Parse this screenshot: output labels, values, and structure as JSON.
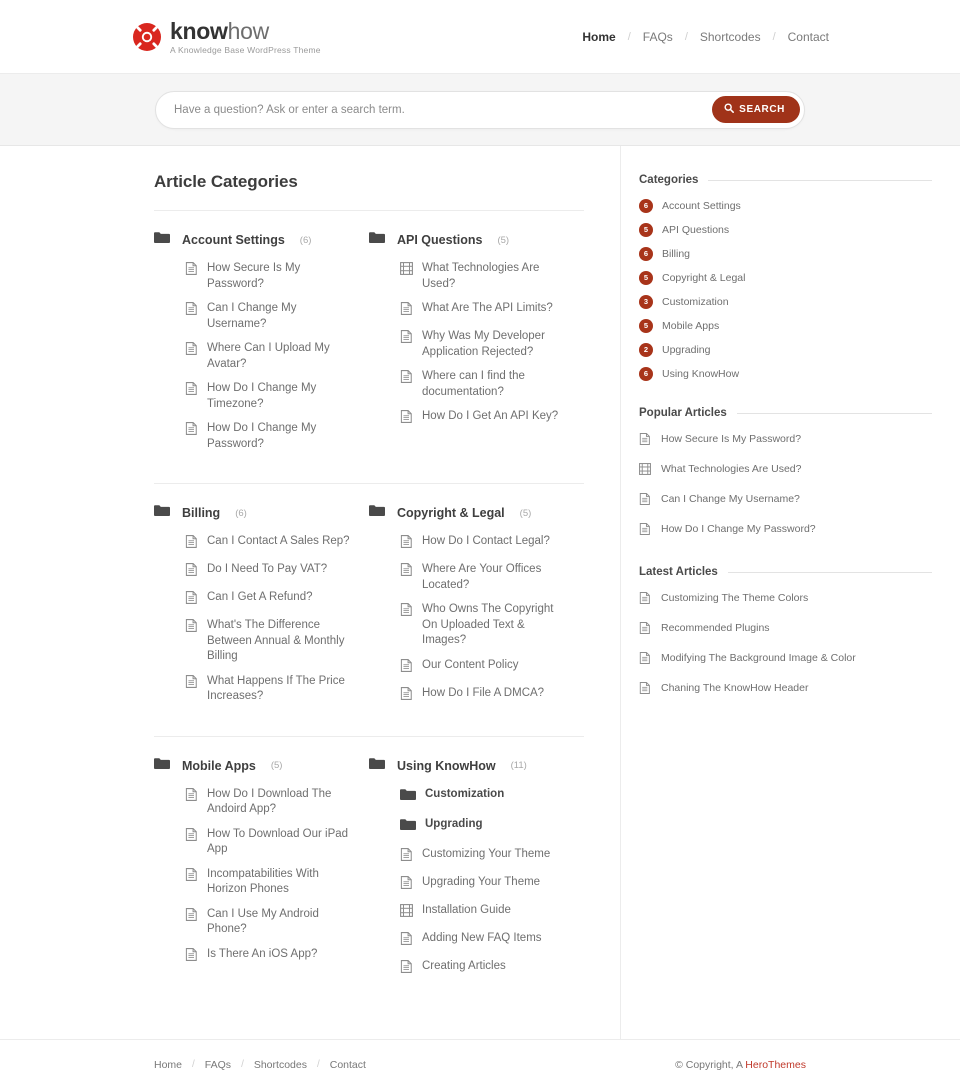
{
  "header": {
    "logo": {
      "icon": "life-ring-icon",
      "title_bold": "know",
      "title_light": "how",
      "tagline": "A Knowledge Base WordPress Theme",
      "brand_color": "#d9271f"
    },
    "nav": [
      {
        "label": "Home",
        "active": true
      },
      {
        "label": "FAQs",
        "active": false
      },
      {
        "label": "Shortcodes",
        "active": false
      },
      {
        "label": "Contact",
        "active": false
      }
    ],
    "nav_separator": "/"
  },
  "search": {
    "placeholder": "Have a question? Ask or enter a search term.",
    "value": "",
    "button_label": "SEARCH",
    "button_icon": "search-icon",
    "button_color": "#a03319"
  },
  "main": {
    "title": "Article Categories",
    "rows": [
      {
        "columns": [
          {
            "name": "Account Settings",
            "count": "(6)",
            "icon": "folder-icon",
            "articles": [
              {
                "label": "How Secure Is My Password?",
                "icon": "document-icon"
              },
              {
                "label": "Can I Change My Username?",
                "icon": "document-icon"
              },
              {
                "label": "Where Can I Upload My Avatar?",
                "icon": "document-icon"
              },
              {
                "label": "How Do I Change My Timezone?",
                "icon": "document-icon"
              },
              {
                "label": "How Do I Change My Password?",
                "icon": "document-icon"
              }
            ]
          },
          {
            "name": "API Questions",
            "count": "(5)",
            "icon": "folder-icon",
            "articles": [
              {
                "label": "What Technologies Are Used?",
                "icon": "video-icon"
              },
              {
                "label": "What Are The API Limits?",
                "icon": "document-icon"
              },
              {
                "label": "Why Was My Developer Application Rejected?",
                "icon": "document-icon"
              },
              {
                "label": "Where can I find the documentation?",
                "icon": "document-icon"
              },
              {
                "label": "How Do I Get An API Key?",
                "icon": "document-icon"
              }
            ]
          }
        ]
      },
      {
        "columns": [
          {
            "name": "Billing",
            "count": "(6)",
            "icon": "folder-icon",
            "articles": [
              {
                "label": "Can I Contact A Sales Rep?",
                "icon": "document-icon"
              },
              {
                "label": "Do I Need To Pay VAT?",
                "icon": "document-icon"
              },
              {
                "label": "Can I Get A Refund?",
                "icon": "document-icon"
              },
              {
                "label": "What's The Difference Between Annual & Monthly Billing",
                "icon": "document-icon"
              },
              {
                "label": "What Happens If The Price Increases?",
                "icon": "document-icon"
              }
            ]
          },
          {
            "name": "Copyright & Legal",
            "count": "(5)",
            "icon": "folder-icon",
            "articles": [
              {
                "label": "How Do I Contact Legal?",
                "icon": "document-icon"
              },
              {
                "label": "Where Are Your Offices Located?",
                "icon": "document-icon"
              },
              {
                "label": "Who Owns The Copyright On Uploaded Text & Images?",
                "icon": "document-icon"
              },
              {
                "label": "Our Content Policy",
                "icon": "document-icon"
              },
              {
                "label": "How Do I File A DMCA?",
                "icon": "document-icon"
              }
            ]
          }
        ]
      },
      {
        "columns": [
          {
            "name": "Mobile Apps",
            "count": "(5)",
            "icon": "folder-icon",
            "articles": [
              {
                "label": "How Do I Download The Andoird App?",
                "icon": "document-icon"
              },
              {
                "label": "How To Download Our iPad App",
                "icon": "document-icon"
              },
              {
                "label": "Incompatabilities With Horizon Phones",
                "icon": "document-icon"
              },
              {
                "label": "Can I Use My Android Phone?",
                "icon": "document-icon"
              },
              {
                "label": "Is There An iOS App?",
                "icon": "document-icon"
              }
            ]
          },
          {
            "name": "Using KnowHow",
            "count": "(11)",
            "icon": "folder-icon",
            "articles": [
              {
                "label": "Customization",
                "icon": "folder-icon",
                "subcategory": true
              },
              {
                "label": "Upgrading",
                "icon": "folder-icon",
                "subcategory": true
              },
              {
                "label": "Customizing Your Theme",
                "icon": "document-icon"
              },
              {
                "label": "Upgrading Your Theme",
                "icon": "document-icon"
              },
              {
                "label": "Installation Guide",
                "icon": "video-icon"
              },
              {
                "label": "Adding New FAQ Items",
                "icon": "document-icon"
              },
              {
                "label": "Creating Articles",
                "icon": "document-icon"
              }
            ]
          }
        ]
      }
    ]
  },
  "sidebar": {
    "categories_widget": {
      "title": "Categories",
      "items": [
        {
          "label": "Account Settings",
          "count": "6"
        },
        {
          "label": "API Questions",
          "count": "5"
        },
        {
          "label": "Billing",
          "count": "6"
        },
        {
          "label": "Copyright & Legal",
          "count": "5"
        },
        {
          "label": "Customization",
          "count": "3"
        },
        {
          "label": "Mobile Apps",
          "count": "5"
        },
        {
          "label": "Upgrading",
          "count": "2"
        },
        {
          "label": "Using KnowHow",
          "count": "6"
        }
      ],
      "badge_color": "#a8341a"
    },
    "popular_widget": {
      "title": "Popular Articles",
      "items": [
        {
          "label": "How Secure Is My Password?",
          "icon": "document-icon"
        },
        {
          "label": "What Technologies Are Used?",
          "icon": "video-icon"
        },
        {
          "label": "Can I Change My Username?",
          "icon": "document-icon"
        },
        {
          "label": "How Do I Change My Password?",
          "icon": "document-icon"
        }
      ]
    },
    "latest_widget": {
      "title": "Latest Articles",
      "items": [
        {
          "label": "Customizing The Theme Colors",
          "icon": "document-icon"
        },
        {
          "label": "Recommended Plugins",
          "icon": "document-icon"
        },
        {
          "label": "Modifying The Background Image & Color",
          "icon": "document-icon"
        },
        {
          "label": "Chaning The KnowHow Header",
          "icon": "document-icon"
        }
      ]
    }
  },
  "footer": {
    "nav": [
      {
        "label": "Home"
      },
      {
        "label": "FAQs"
      },
      {
        "label": "Shortcodes"
      },
      {
        "label": "Contact"
      }
    ],
    "nav_separator": "/",
    "copyright_prefix": "© Copyright, A ",
    "copyright_link": "HeroThemes",
    "link_color": "#c0392b"
  }
}
